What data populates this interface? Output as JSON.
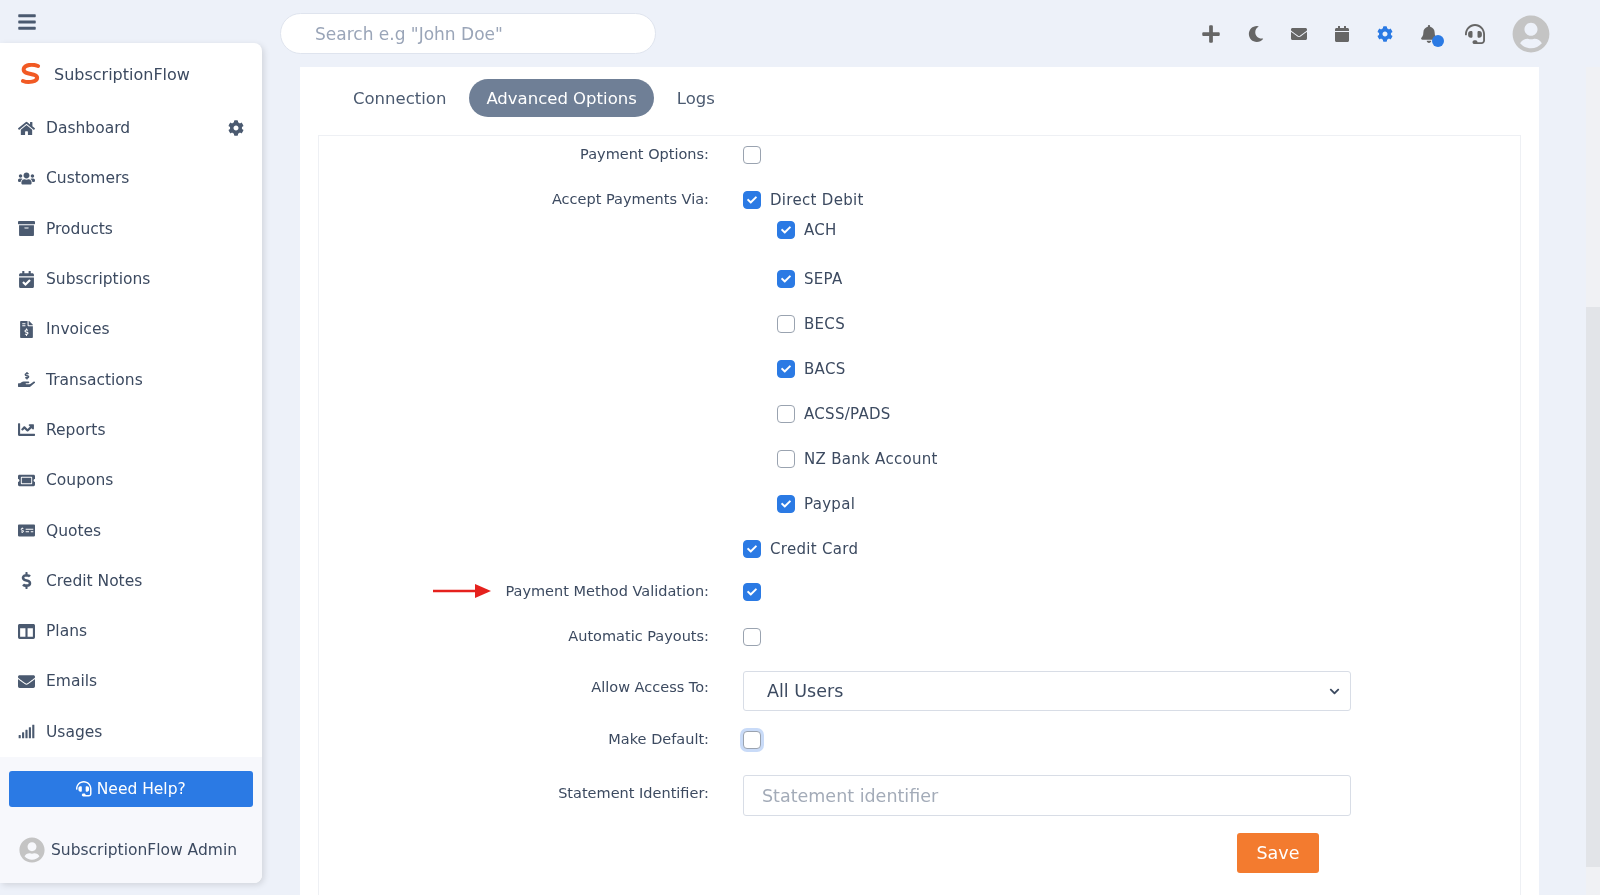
{
  "topbar": {
    "search": {
      "placeholder": "Search e.g \"John Doe\""
    },
    "notification_dot": true
  },
  "sidebar": {
    "brand": "SubscriptionFlow",
    "items": [
      {
        "label": "Dashboard",
        "settings": true
      },
      {
        "label": "Customers",
        "settings": false
      },
      {
        "label": "Products",
        "settings": false
      },
      {
        "label": "Subscriptions",
        "settings": false
      },
      {
        "label": "Invoices",
        "settings": false
      },
      {
        "label": "Transactions",
        "settings": false
      },
      {
        "label": "Reports",
        "settings": false
      },
      {
        "label": "Coupons",
        "settings": false
      },
      {
        "label": "Quotes",
        "settings": false
      },
      {
        "label": "Credit Notes",
        "settings": false
      },
      {
        "label": "Plans",
        "settings": false
      },
      {
        "label": "Emails",
        "settings": false
      },
      {
        "label": "Usages",
        "settings": false
      }
    ],
    "help_button": "Need Help?",
    "user": "SubscriptionFlow Admin"
  },
  "tabs": [
    {
      "label": "Connection",
      "selected": false
    },
    {
      "label": "Advanced Options",
      "selected": true
    },
    {
      "label": "Logs",
      "selected": false
    }
  ],
  "form": {
    "rows": [
      {
        "kind": "checkbox",
        "label": "Payment Options:",
        "checked": false
      },
      {
        "kind": "options",
        "label": "Accept Payments Via:",
        "options": [
          {
            "label": "Direct Debit",
            "checked": true,
            "children": [
              {
                "label": "ACH",
                "checked": true
              },
              {
                "label": "SEPA",
                "checked": true
              },
              {
                "label": "BECS",
                "checked": false
              },
              {
                "label": "BACS",
                "checked": true
              },
              {
                "label": "ACSS/PADS",
                "checked": false
              },
              {
                "label": "NZ Bank Account",
                "checked": false
              },
              {
                "label": "Paypal",
                "checked": true
              }
            ]
          },
          {
            "label": "Credit Card",
            "checked": true
          }
        ]
      },
      {
        "kind": "checkbox",
        "label": "Payment Method Validation:",
        "checked": true,
        "highlighted": true
      },
      {
        "kind": "checkbox",
        "label": "Automatic Payouts:",
        "checked": false
      },
      {
        "kind": "select",
        "label": "Allow Access To:",
        "value": "All Users"
      },
      {
        "kind": "checkbox",
        "label": "Make Default:",
        "checked": false,
        "focused": true
      },
      {
        "kind": "text",
        "label": "Statement Identifier:",
        "placeholder": "Statement identifier"
      }
    ],
    "save_button": "Save"
  }
}
